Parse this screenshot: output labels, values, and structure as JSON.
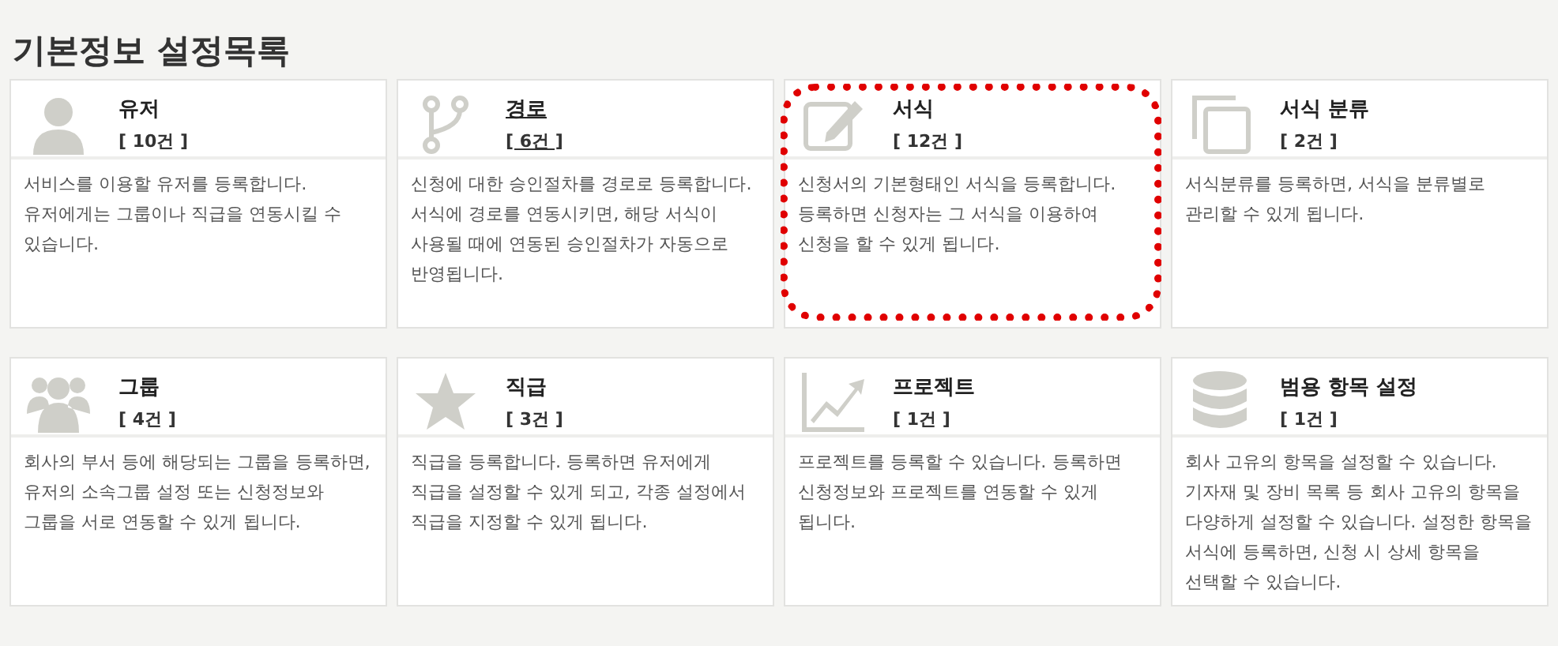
{
  "page": {
    "title": "기본정보 설정목록"
  },
  "cards": [
    {
      "title": "유저",
      "count": "[ 10건 ]",
      "description": "서비스를 이용할 유저를 등록합니다. 유저에게는 그룹이나 직급을 연동시킬 수 있습니다.",
      "hovered": false,
      "highlighted": false
    },
    {
      "title": "경로",
      "count": "[ 6건 ]",
      "description": "신청에 대한 승인절차를 경로로 등록합니다. 서식에 경로를 연동시키면, 해당 서식이 사용될 때에 연동된 승인절차가 자동으로 반영됩니다.",
      "hovered": true,
      "highlighted": false
    },
    {
      "title": "서식",
      "count": "[ 12건 ]",
      "description": "신청서의 기본형태인 서식을 등록합니다. 등록하면 신청자는 그 서식을 이용하여 신청을 할 수 있게 됩니다.",
      "hovered": false,
      "highlighted": true
    },
    {
      "title": "서식 분류",
      "count": "[ 2건 ]",
      "description": "서식분류를 등록하면, 서식을 분류별로 관리할 수 있게 됩니다.",
      "hovered": false,
      "highlighted": false
    },
    {
      "title": "그룹",
      "count": "[ 4건 ]",
      "description": "회사의 부서 등에 해당되는 그룹을 등록하면, 유저의 소속그룹 설정 또는 신청정보와 그룹을 서로 연동할 수 있게 됩니다.",
      "hovered": false,
      "highlighted": false
    },
    {
      "title": "직급",
      "count": "[ 3건 ]",
      "description": "직급을 등록합니다. 등록하면 유저에게 직급을 설정할 수 있게 되고, 각종 설정에서 직급을 지정할 수 있게 됩니다.",
      "hovered": false,
      "highlighted": false
    },
    {
      "title": "프로젝트",
      "count": "[ 1건 ]",
      "description": "프로젝트를 등록할 수 있습니다. 등록하면 신청정보와 프로젝트를 연동할 수 있게 됩니다.",
      "hovered": false,
      "highlighted": false
    },
    {
      "title": "범용 항목 설정",
      "count": "[ 1건 ]",
      "description": "회사 고유의 항목을 설정할 수 있습니다. 기자재 및 장비 목록 등 회사 고유의 항목을 다양하게 설정할 수 있습니다. 설정한 항목을 서식에 등록하면, 신청 시 상세 항목을 선택할 수 있습니다.",
      "hovered": false,
      "highlighted": false
    }
  ]
}
